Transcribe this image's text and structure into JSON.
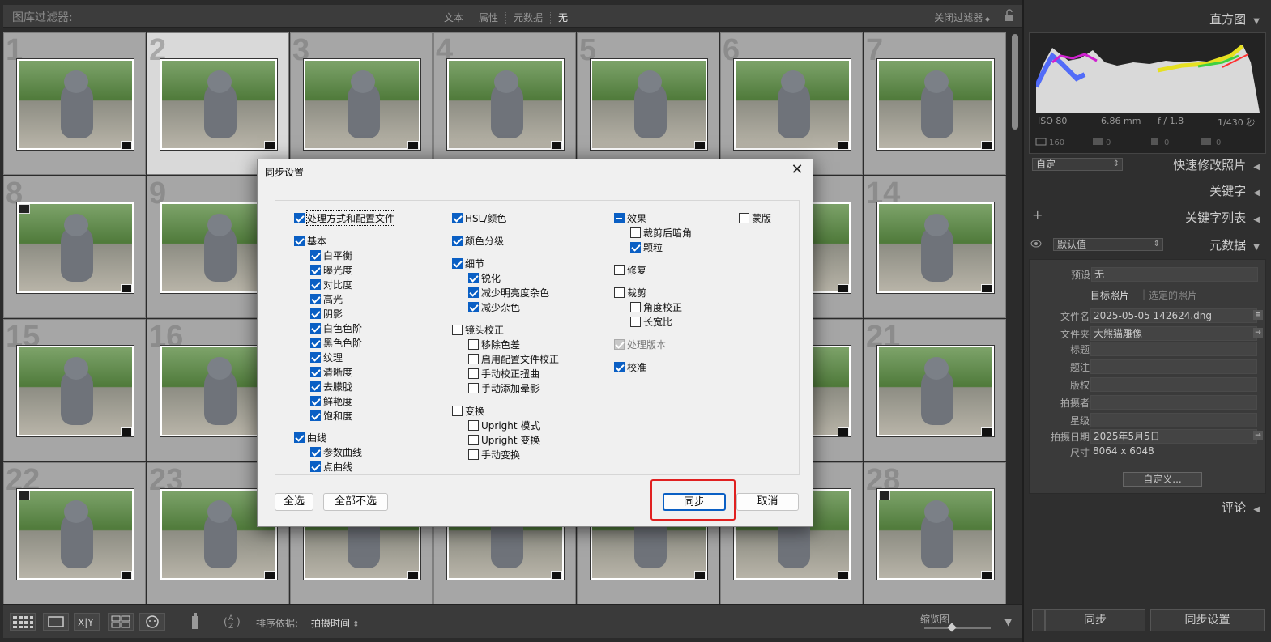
{
  "filter_bar": {
    "title": "图库过滤器:",
    "options": [
      "文本",
      "属性",
      "元数据",
      "无"
    ],
    "active_option": "无",
    "close_filters": "关闭过滤器"
  },
  "grid": {
    "cells": [
      {
        "num": "1"
      },
      {
        "num": "2",
        "selected": true
      },
      {
        "num": "3"
      },
      {
        "num": "4"
      },
      {
        "num": "5"
      },
      {
        "num": "6"
      },
      {
        "num": "7"
      },
      {
        "num": "8"
      },
      {
        "num": "9"
      },
      {
        "num": ""
      },
      {
        "num": ""
      },
      {
        "num": ""
      },
      {
        "num": ""
      },
      {
        "num": "14"
      },
      {
        "num": "15"
      },
      {
        "num": "16"
      },
      {
        "num": ""
      },
      {
        "num": ""
      },
      {
        "num": ""
      },
      {
        "num": ""
      },
      {
        "num": "21"
      },
      {
        "num": "22"
      },
      {
        "num": "23"
      },
      {
        "num": ""
      },
      {
        "num": ""
      },
      {
        "num": ""
      },
      {
        "num": ""
      },
      {
        "num": "28"
      }
    ]
  },
  "toolbar": {
    "sort_label": "排序依据:",
    "sort_value": "拍摄时间",
    "thumbnail_label": "缩览图",
    "sort_az": "AZ"
  },
  "right_panel": {
    "histogram_title": "直方图",
    "exif": {
      "iso": "ISO 80",
      "focal": "6.86 mm",
      "aperture": "f / 1.8",
      "shutter": "1/430 秒"
    },
    "quick_develop": {
      "title": "快速修改照片",
      "preset": "自定"
    },
    "keywording": "关键字",
    "keyword_list": "关键字列表",
    "metadata": {
      "title": "元数据",
      "preset_select": "默认值",
      "preset_label": "预设",
      "preset_value": "无",
      "tab_target": "目标照片",
      "tab_selected": "选定的照片",
      "rows": [
        {
          "key": "文件名",
          "value": "2025-05-05 142624.dng"
        },
        {
          "key": "文件夹",
          "value": "大熊猫雕像"
        },
        {
          "key": "标题",
          "value": ""
        },
        {
          "key": "题注",
          "value": ""
        },
        {
          "key": "版权",
          "value": ""
        },
        {
          "key": "拍摄者",
          "value": ""
        },
        {
          "key": "星级",
          "value": ""
        },
        {
          "key": "拍摄日期",
          "value": "2025年5月5日"
        },
        {
          "key": "尺寸",
          "value": "8064 x 6048"
        }
      ],
      "customize": "自定义..."
    },
    "comments": "评论",
    "sync_button": "同步",
    "sync_settings_button": "同步设置"
  },
  "dialog": {
    "title": "同步设置",
    "col1": {
      "process": "处理方式和配置文件",
      "basic": "基本",
      "basic_items": [
        "白平衡",
        "曝光度",
        "对比度",
        "高光",
        "阴影",
        "白色色阶",
        "黑色色阶",
        "纹理",
        "清晰度",
        "去朦胧",
        "鲜艳度",
        "饱和度"
      ],
      "curve": "曲线",
      "curve_items": [
        "参数曲线",
        "点曲线"
      ]
    },
    "col2": {
      "hsl": "HSL/颜色",
      "color_grading": "颜色分级",
      "detail": "细节",
      "detail_items": [
        "锐化",
        "减少明亮度杂色",
        "减少杂色"
      ],
      "lens": "镜头校正",
      "lens_items": [
        "移除色差",
        "启用配置文件校正",
        "手动校正扭曲",
        "手动添加晕影"
      ],
      "transform": "变换",
      "transform_items": [
        "Upright 模式",
        "Upright 变换",
        "手动变换"
      ]
    },
    "col3": {
      "effects": "效果",
      "effects_items": [
        "裁剪后暗角",
        "颗粒"
      ],
      "spot": "修复",
      "crop": "裁剪",
      "crop_items": [
        "角度校正",
        "长宽比"
      ],
      "process_version": "处理版本",
      "calibration": "校准"
    },
    "col4": {
      "masking": "蒙版"
    },
    "select_all": "全选",
    "select_none": "全部不选",
    "sync": "同步",
    "cancel": "取消"
  }
}
